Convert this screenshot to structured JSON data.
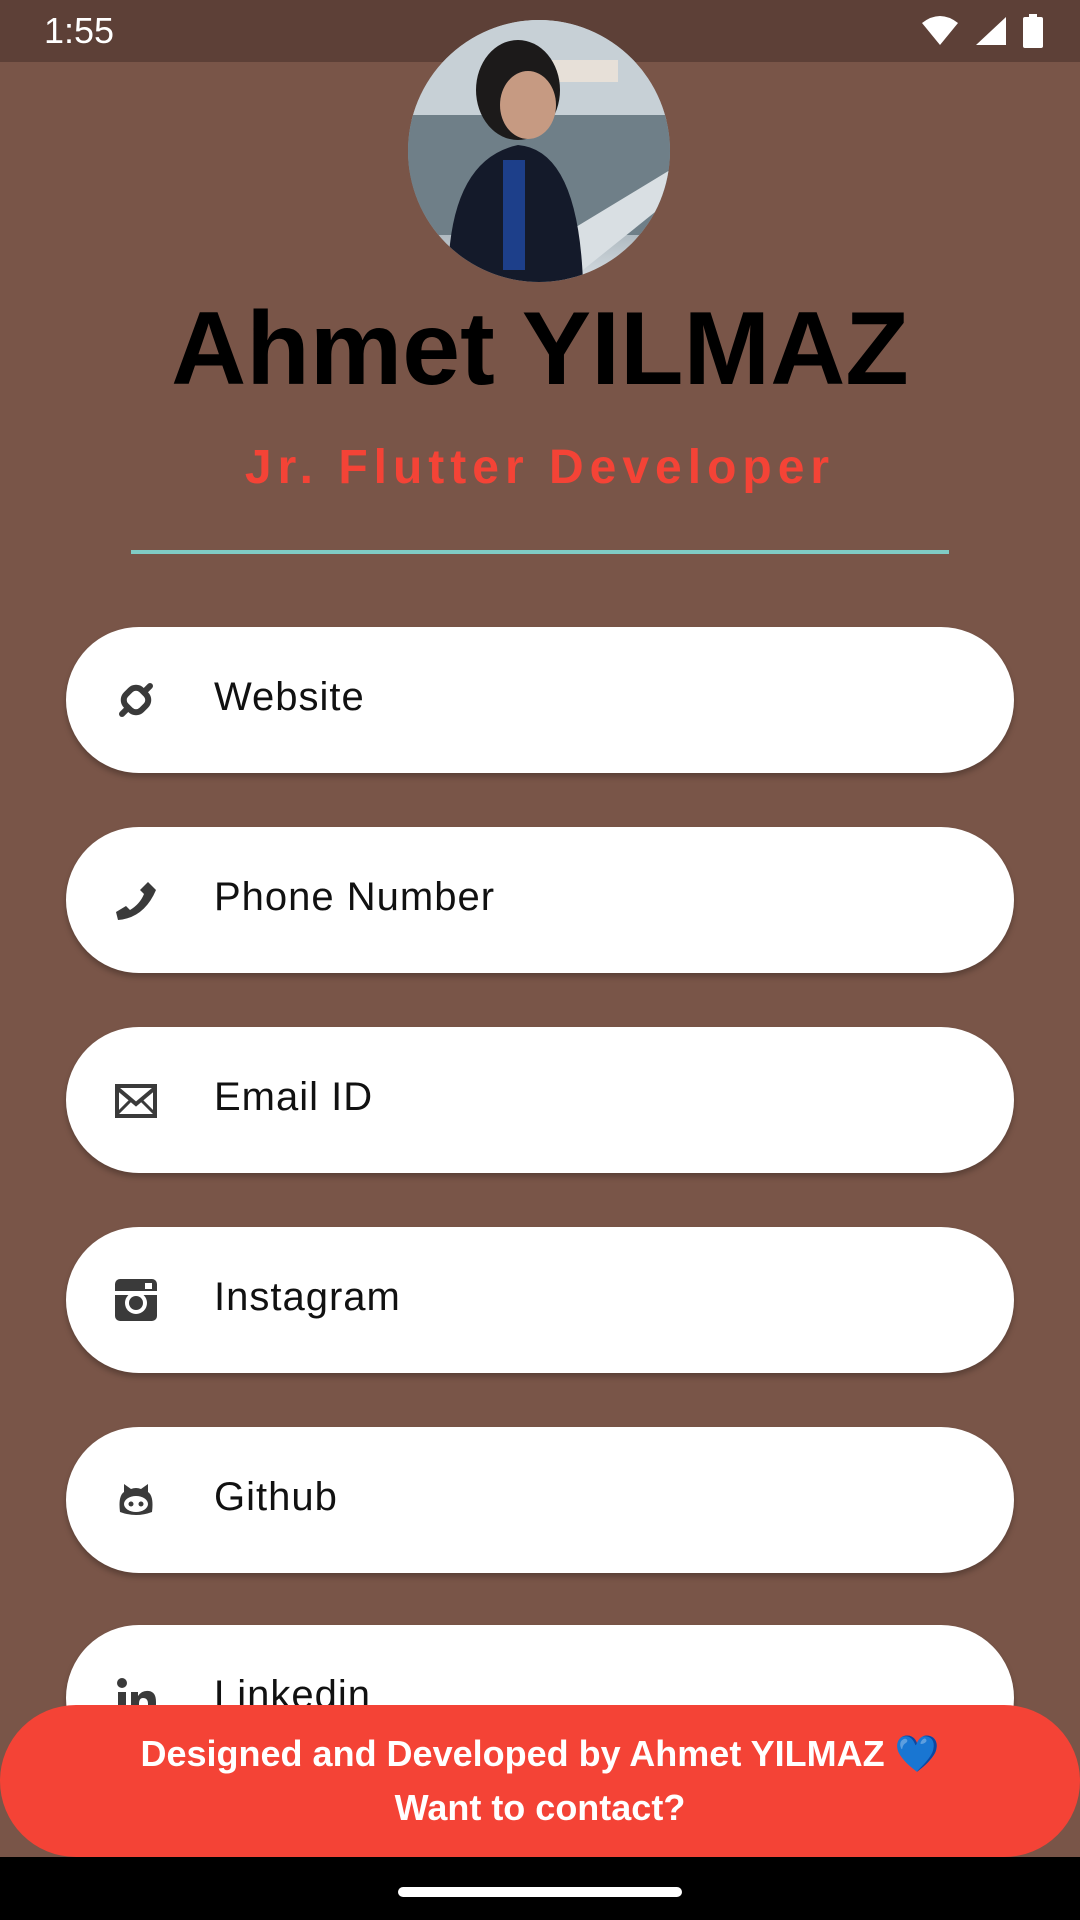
{
  "status_bar": {
    "time": "1:55",
    "icons": [
      "wifi-icon",
      "signal-icon",
      "battery-icon"
    ]
  },
  "profile": {
    "name": "Ahmet YILMAZ",
    "role": "Jr. Flutter Developer",
    "avatar": "profile-photo"
  },
  "links": [
    {
      "label": "Website",
      "icon": "link-icon"
    },
    {
      "label": "Phone Number",
      "icon": "phone-icon"
    },
    {
      "label": "Email ID",
      "icon": "email-icon"
    },
    {
      "label": "Instagram",
      "icon": "instagram-icon"
    },
    {
      "label": "Github",
      "icon": "github-icon"
    },
    {
      "label": "Linkedin",
      "icon": "linkedin-icon"
    }
  ],
  "footer": {
    "line1": "Designed and Developed by Ahmet YILMAZ 💙",
    "line2": "Want to contact?"
  },
  "colors": {
    "background": "#795548",
    "status_bar": "#5d4037",
    "accent_red": "#f44336",
    "divider_teal": "#80cbc4"
  }
}
